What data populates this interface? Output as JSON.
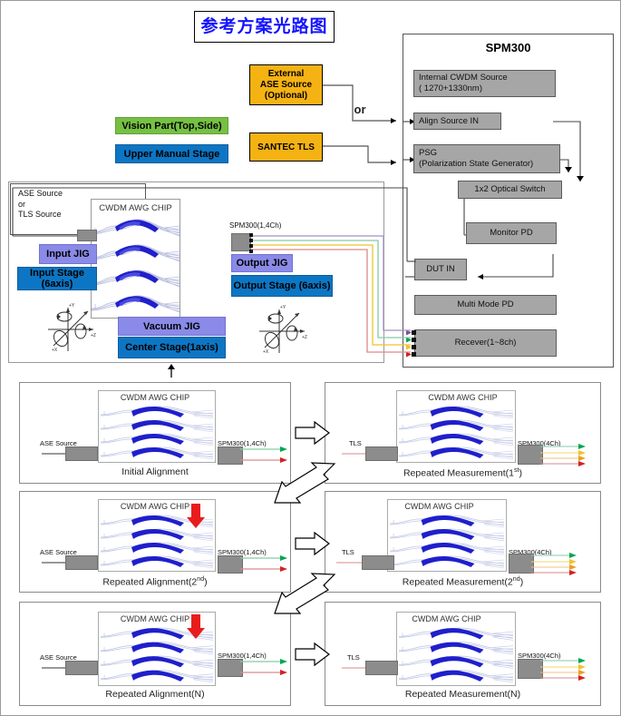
{
  "title": "参考方案光路图",
  "sources": {
    "external_ase": "External\nASE Source\n(Optional)",
    "santec_tls": "SANTEC TLS",
    "or_label": "or"
  },
  "stage_labels": {
    "vision_part": "Vision Part(Top,Side)",
    "upper_manual_stage": "Upper Manual Stage",
    "input_jig": "Input JIG",
    "input_stage": "Input Stage (6axis)",
    "output_jig": "Output JIG",
    "output_stage": "Output Stage (6axis)",
    "vacuum_jig": "Vacuum JIG",
    "center_stage": "Center Stage(1axis)"
  },
  "stage_panel": {
    "source_note": "ASE Source\nor\nTLS Source",
    "chip_title": "CWDM AWG CHIP",
    "spm_output_label": "SPM300(1,4Ch)"
  },
  "spm300": {
    "title": "SPM300",
    "blocks": [
      {
        "id": "internal-cwdm-source",
        "label": "Internal CWDM Source\n( 1270+1330nm)"
      },
      {
        "id": "align-source-in",
        "label": "Align Source IN"
      },
      {
        "id": "psg",
        "label": "PSG\n(Polarization State Generator)"
      },
      {
        "id": "optical-switch",
        "label": "1x2 Optical Switch"
      },
      {
        "id": "monitor-pd",
        "label": "Monitor PD"
      },
      {
        "id": "dut-in",
        "label": "DUT IN"
      },
      {
        "id": "multi-mode-pd",
        "label": "Multi Mode PD"
      },
      {
        "id": "receiver",
        "label": "Recever(1~8ch)"
      }
    ]
  },
  "fiber_colors": {
    "purple": "#a58fc4",
    "green": "#84c9a8",
    "yellow": "#f2c12e",
    "red": "#d98a8a",
    "arrow_green": "#00a650",
    "arrow_red": "#d42121",
    "arrow_yellow": "#f2c12e",
    "arrow_orange": "#e8a020",
    "arrow_purple": "#7b4fa0"
  },
  "accent_colors": {
    "title_blue": "#1414ff",
    "green_box": "#76c043",
    "blue_box": "#0d76c4",
    "purple_box": "#8a8ae8",
    "orange_box": "#f5b213",
    "gray_box": "#a6a6a6",
    "red_marker": "#e81c1c"
  },
  "process_panels": [
    {
      "id": "initial-alignment",
      "title": "Initial Alignment",
      "source": "ASE Source",
      "chip": "CWDM AWG CHIP",
      "output": "SPM300(1,4Ch)",
      "channels": 2,
      "marker": false
    },
    {
      "id": "repeated-measurement-1st",
      "title": "Repeated Measurement(1st)",
      "title_main": "Repeated Measurement(1",
      "title_sup": "st",
      "title_tail": ")",
      "source": "TLS",
      "chip": "CWDM AWG CHIP",
      "output": "SPM300(4Ch)",
      "channels": 4,
      "marker": false
    },
    {
      "id": "repeated-alignment-2nd",
      "title": "Repeated Alignment(2nd)",
      "title_main": "Repeated Alignment(2",
      "title_sup": "nd",
      "title_tail": ")",
      "source": "ASE Source",
      "chip": "CWDM AWG CHIP",
      "output": "SPM300(1,4Ch)",
      "channels": 2,
      "marker": true
    },
    {
      "id": "repeated-measurement-2nd",
      "title": "Repeated Measurement(2nd)",
      "title_main": "Repeated Measurement(2",
      "title_sup": "nd",
      "title_tail": ")",
      "source": "TLS",
      "chip": "CWDM AWG CHIP",
      "output": "SPM300(4Ch)",
      "channels": 4,
      "marker": false
    },
    {
      "id": "repeated-alignment-n",
      "title": "Repeated Alignment(N)",
      "source": "ASE Source",
      "chip": "CWDM AWG CHIP",
      "output": "SPM300(1,4Ch)",
      "channels": 2,
      "marker": true
    },
    {
      "id": "repeated-measurement-n",
      "title": "Repeated Measurement(N)",
      "source": "TLS",
      "chip": "CWDM AWG CHIP",
      "output": "SPM300(4Ch)",
      "channels": 4,
      "marker": false
    }
  ]
}
